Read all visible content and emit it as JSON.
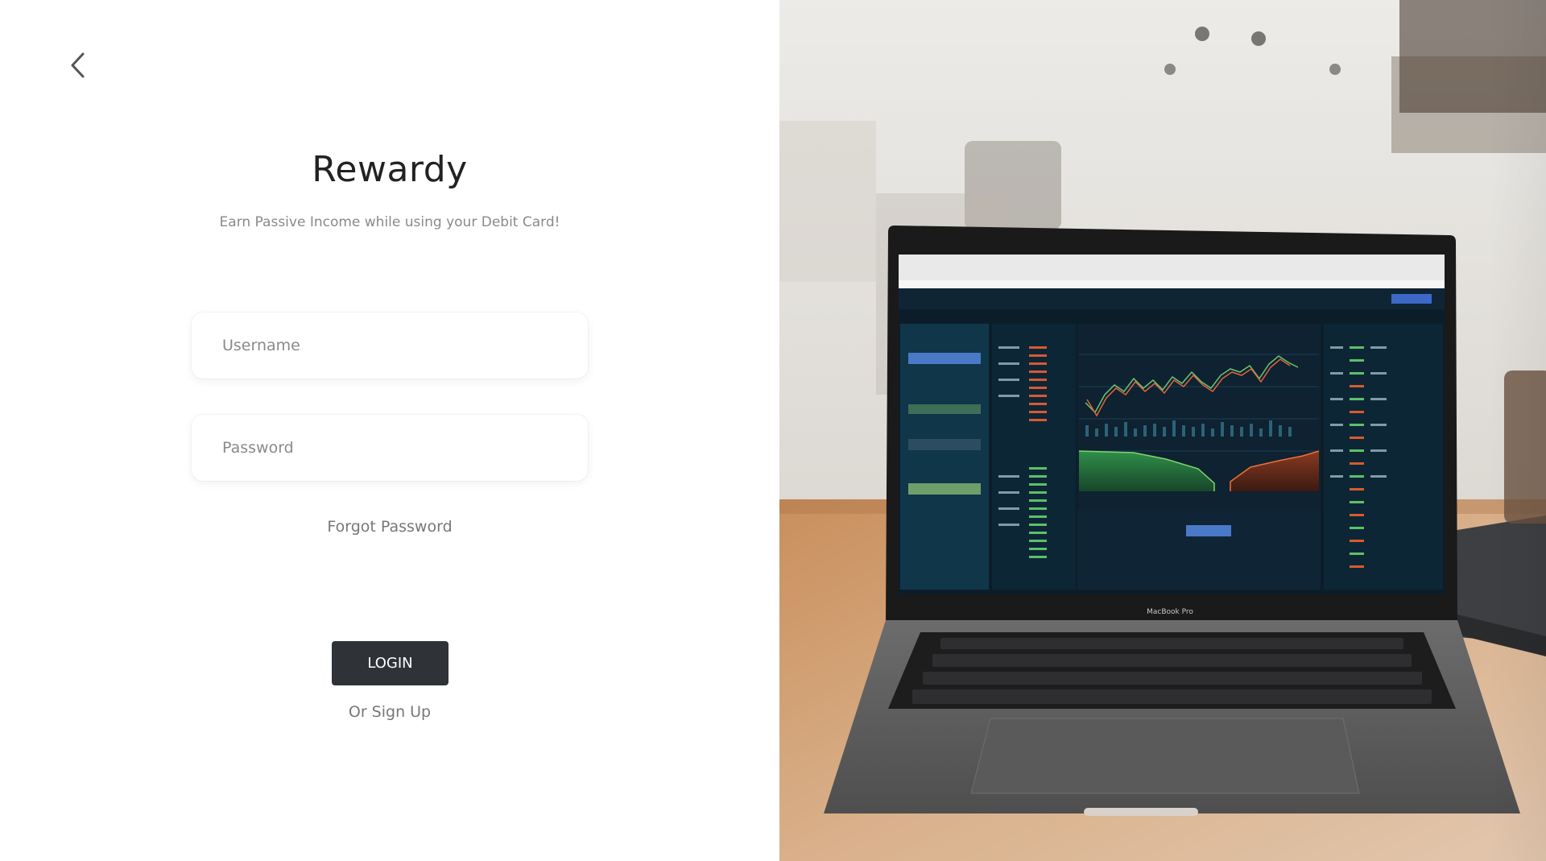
{
  "app": {
    "brand": "Rewardy",
    "tagline": "Earn Passive Income while using your Debit Card!"
  },
  "nav": {
    "back_icon": "chevron-left-icon"
  },
  "form": {
    "username_placeholder": "Username",
    "username_value": "",
    "password_placeholder": "Password",
    "password_value": "",
    "forgot_label": "Forgot Password",
    "login_label": "LOGIN",
    "signup_label": "Or Sign Up"
  },
  "hero": {
    "laptop_label": "MacBook Pro"
  },
  "colors": {
    "button_bg": "#2f3237",
    "text_primary": "#222222",
    "text_muted": "#777777"
  }
}
